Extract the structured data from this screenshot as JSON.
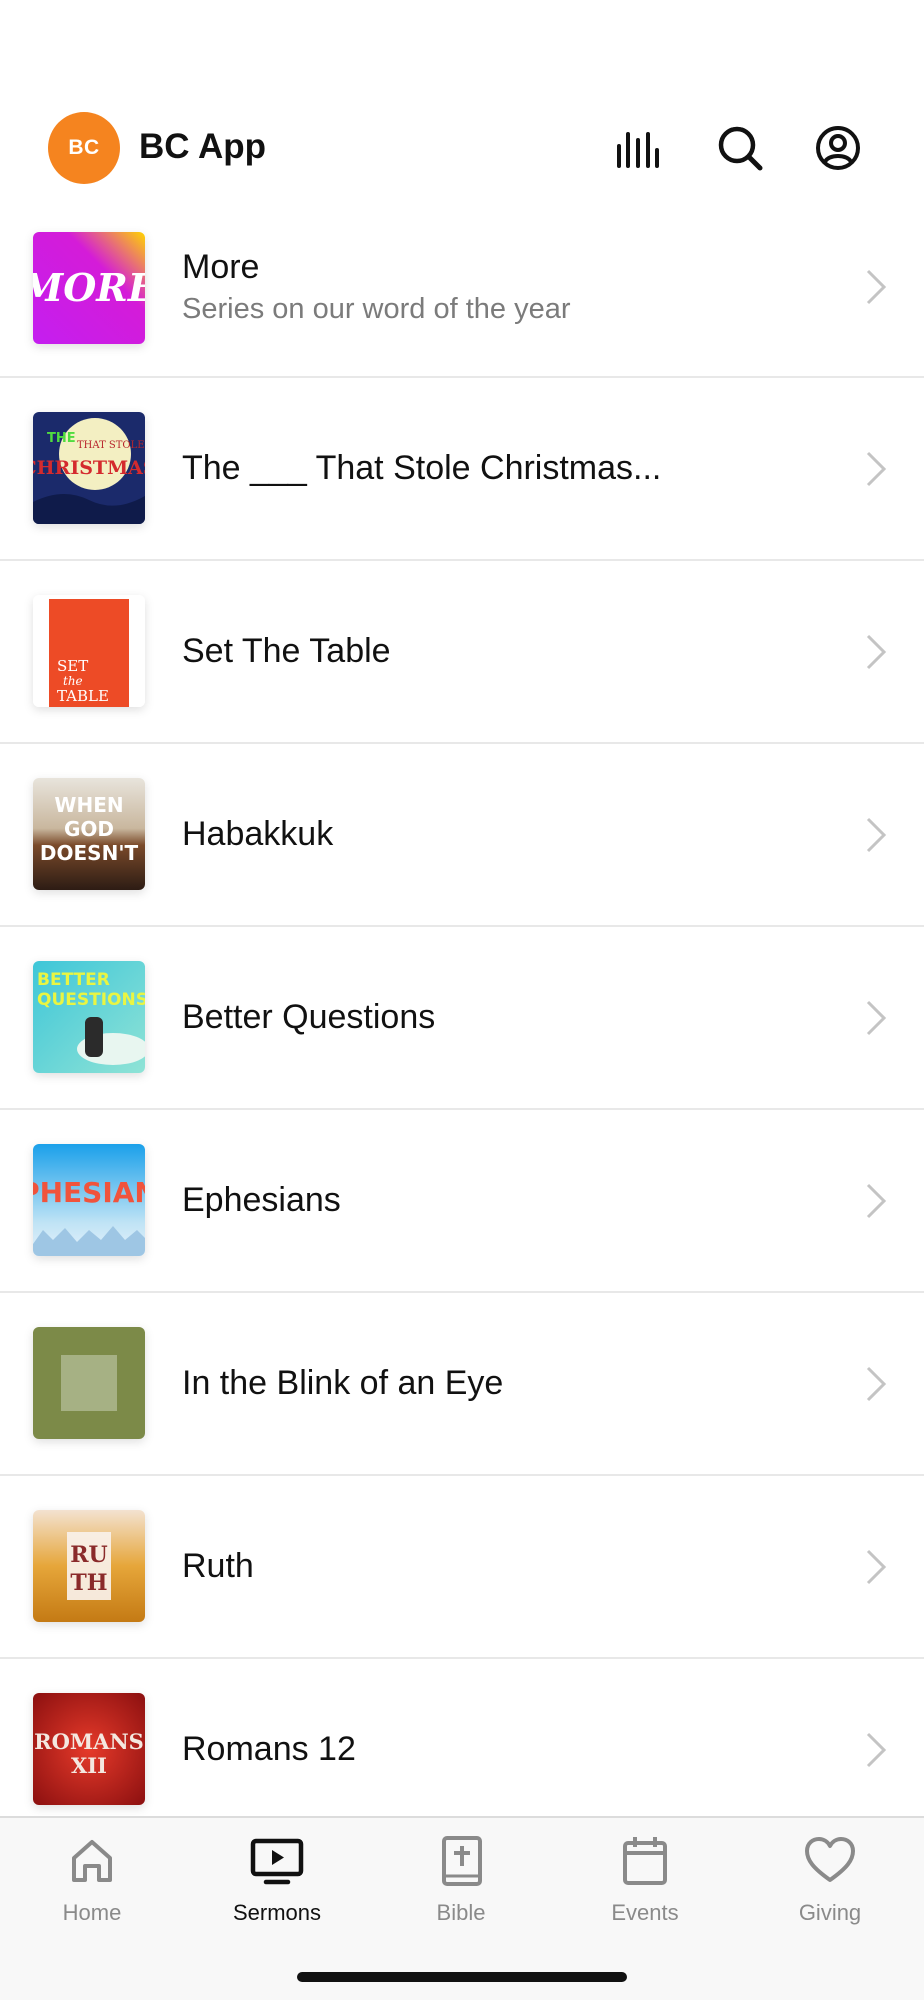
{
  "header": {
    "logo_text": "BC",
    "app_title": "BC App",
    "icons": [
      "audio-bars-icon",
      "search-icon",
      "account-icon"
    ],
    "brand_color": "#f5841f"
  },
  "series": [
    {
      "title": "More",
      "subtitle": "Series on our word of the year",
      "thumb_text": "MORE"
    },
    {
      "title": "The ___ That Stole Christmas...",
      "subtitle": "",
      "thumb_text": "THE THAT STOLE CHRISTMAS"
    },
    {
      "title": "Set The Table",
      "subtitle": "",
      "thumb_text": "SET the TABLE"
    },
    {
      "title": "Habakkuk",
      "subtitle": "",
      "thumb_text": "WHEN GOD DOESN'T"
    },
    {
      "title": "Better Questions",
      "subtitle": "",
      "thumb_text": "BETTER QUESTIONS"
    },
    {
      "title": "Ephesians",
      "subtitle": "",
      "thumb_text": "EPHESIANS"
    },
    {
      "title": "In the Blink of an Eye",
      "subtitle": "",
      "thumb_text": ""
    },
    {
      "title": "Ruth",
      "subtitle": "",
      "thumb_text": "RUTH"
    },
    {
      "title": "Romans 12",
      "subtitle": "",
      "thumb_text": "ROMANS XII"
    }
  ],
  "tabs": [
    {
      "label": "Home",
      "icon": "home-icon",
      "active": false
    },
    {
      "label": "Sermons",
      "icon": "tv-play-icon",
      "active": true
    },
    {
      "label": "Bible",
      "icon": "bible-icon",
      "active": false
    },
    {
      "label": "Events",
      "icon": "calendar-icon",
      "active": false
    },
    {
      "label": "Giving",
      "icon": "heart-icon",
      "active": false
    }
  ]
}
